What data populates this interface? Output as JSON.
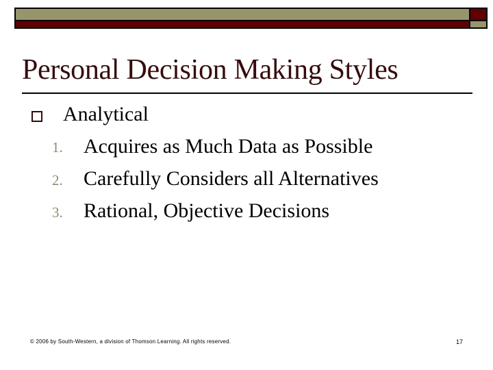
{
  "slide": {
    "title": "Personal Decision Making Styles",
    "bullet": {
      "icon": "hollow-square-bullet",
      "text": "Analytical",
      "items": [
        {
          "number": "1.",
          "text": "Acquires as Much Data as Possible"
        },
        {
          "number": "2.",
          "text": "Carefully Considers all Alternatives"
        },
        {
          "number": "3.",
          "text": "Rational, Objective Decisions"
        }
      ]
    },
    "footer": "© 2006 by South-Western, a division of Thomson Learning. All rights reserved.",
    "page_number": "17"
  },
  "colors": {
    "olive": "#96966a",
    "dark_red": "#600000",
    "title": "#3a0a0a",
    "numbering": "#8c8c6e"
  }
}
